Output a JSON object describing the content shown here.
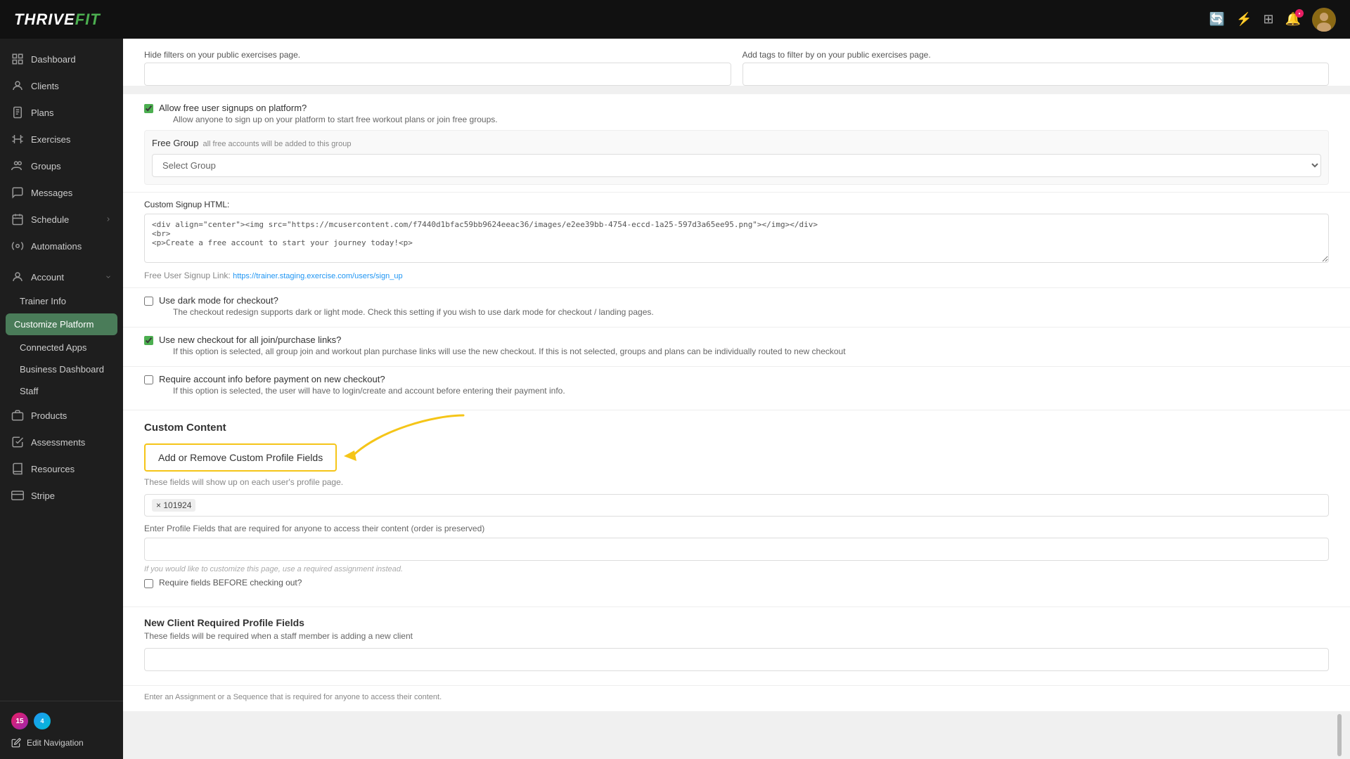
{
  "app": {
    "name": "THRIVEFIT",
    "name_highlight": "FIT"
  },
  "topbar": {
    "icons": [
      "refresh-icon",
      "bolt-icon",
      "grid-icon",
      "bell-icon",
      "avatar-icon"
    ]
  },
  "sidebar": {
    "nav_items": [
      {
        "id": "dashboard",
        "label": "Dashboard",
        "icon": "home"
      },
      {
        "id": "clients",
        "label": "Clients",
        "icon": "people"
      },
      {
        "id": "plans",
        "label": "Plans",
        "icon": "clipboard"
      },
      {
        "id": "exercises",
        "label": "Exercises",
        "icon": "dumbbell"
      },
      {
        "id": "groups",
        "label": "Groups",
        "icon": "users"
      },
      {
        "id": "messages",
        "label": "Messages",
        "icon": "chat"
      },
      {
        "id": "schedule",
        "label": "Schedule",
        "icon": "calendar",
        "has_arrow": true
      },
      {
        "id": "automations",
        "label": "Automations",
        "icon": "gear"
      }
    ],
    "account_section": {
      "label": "Account",
      "sub_items": [
        {
          "id": "trainer-info",
          "label": "Trainer Info",
          "active": false
        },
        {
          "id": "customize-platform",
          "label": "Customize Platform",
          "active": true
        },
        {
          "id": "connected-apps",
          "label": "Connected Apps",
          "active": false
        },
        {
          "id": "business-dashboard",
          "label": "Business Dashboard",
          "active": false
        },
        {
          "id": "staff",
          "label": "Staff",
          "active": false
        }
      ]
    },
    "more_items": [
      {
        "id": "products",
        "label": "Products"
      },
      {
        "id": "assessments",
        "label": "Assessments"
      },
      {
        "id": "resources",
        "label": "Resources"
      },
      {
        "id": "stripe",
        "label": "Stripe"
      }
    ],
    "bottom": {
      "badge_count": "15",
      "badge_count2": "4",
      "edit_nav_label": "Edit Navigation"
    }
  },
  "content": {
    "filters_section": {
      "hide_filters_label": "Hide filters on your public exercises page.",
      "add_tags_label": "Add tags to filter by on your public exercises page."
    },
    "free_signup": {
      "checkbox_label": "Allow free user signups on platform?",
      "checkbox_desc": "Allow anyone to sign up on your platform to start free workout plans or join free groups.",
      "free_group_label": "Free Group",
      "free_group_desc": "all free accounts will be added to this group",
      "select_placeholder": "Select Group"
    },
    "custom_html": {
      "label": "Custom Signup HTML:",
      "value": "<div align=\"center\"><img src=\"https://mcusercontent.com/f7440d1bfac59bb9624eeac36/images/e2ee39bb-4754-eccd-1a25-597d3a65ee95.png\"></img></div>\n<br>\n<p>Create a free account to start your journey today!<p>",
      "signup_link_label": "Free User Signup Link:",
      "signup_link_url": "https://trainer.staging.exercise.com/users/sign_up"
    },
    "dark_mode": {
      "checkbox_label": "Use dark mode for checkout?",
      "checkbox_desc": "The checkout redesign supports dark or light mode. Check this setting if you wish to use dark mode for checkout / landing pages."
    },
    "new_checkout": {
      "checkbox_label": "Use new checkout for all join/purchase links?",
      "checkbox_desc": "If this option is selected, all group join and workout plan purchase links will use the new checkout. If this is not selected, groups and plans can be individually routed to new checkout",
      "checked": true
    },
    "require_account": {
      "checkbox_label": "Require account info before payment on new checkout?",
      "checkbox_desc": "If this option is selected, the user will have to login/create and account before entering their payment info."
    },
    "custom_content": {
      "title": "Custom Content",
      "add_remove_btn": "Add or Remove Custom Profile Fields",
      "add_remove_desc": "These fields will show up on each user's profile page.",
      "tag_value": "× 101924",
      "profile_fields_label": "Enter Profile Fields that are required for anyone to access their content (order is preserved)",
      "note_text": "If you would like to customize this page, use a required assignment instead.",
      "require_checkout_label": "Require fields BEFORE checking out?"
    },
    "new_client": {
      "title": "New Client Required Profile Fields",
      "desc": "These fields will be required when a staff member is adding a new client"
    },
    "footer_text": "Enter an Assignment or a Sequence that is required for anyone to access their content."
  }
}
